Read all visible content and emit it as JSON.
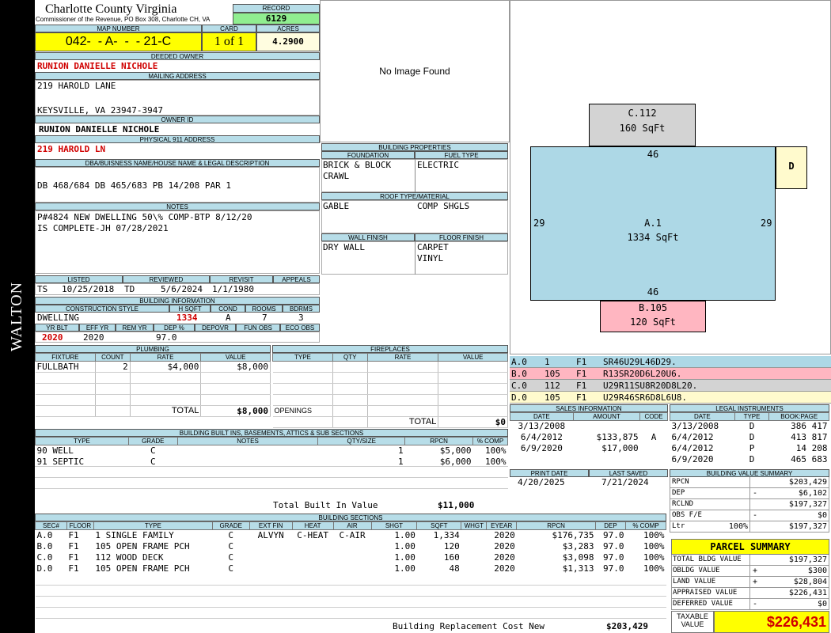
{
  "side_label": "WALTON",
  "header": {
    "county": "Charlotte County Virginia",
    "commissioner": "Commissioner of the Revenue, PO Box 308, Charlotte CH, VA",
    "record_label": "RECORD",
    "record": "6129",
    "map_label": "MAP NUMBER",
    "map_number": "042-  - A-  -  - 21-C",
    "card_label": "CARD",
    "card": "1 of 1",
    "acres_label": "ACRES",
    "acres": "4.2900"
  },
  "owner": {
    "deeded_label": "DEEDED OWNER",
    "deeded": "RUNION DANIELLE NICHOLE",
    "mailing_label": "MAILING ADDRESS",
    "mail1": "219 HAROLD LANE",
    "mail2": "KEYSVILLE, VA 23947-3947",
    "owner_id_label": "OWNER ID",
    "owner_id": "RUNION DANIELLE NICHOLE",
    "physical_label": "PHYSICAL 911 ADDRESS",
    "physical": "219 HAROLD LN",
    "dba_label": "DBA/BUISNESS NAME/HOUSE NAME & LEGAL DESCRIPTION",
    "dba": "DB 468/684 DB 465/683 PB 14/208 PAR 1",
    "notes_label": "NOTES",
    "notes1": "P#4824 NEW DWELLING 50\\% COMP-BTP 8/12/20",
    "notes2": "IS COMPLETE-JH 07/28/2021"
  },
  "photo": {
    "text": "No Image Found"
  },
  "building_props": {
    "title": "BUILDING PROPERTIES",
    "foundation_label": "FOUNDATION",
    "foundation1": "BRICK & BLOCK",
    "foundation2": "CRAWL",
    "fuel_label": "FUEL TYPE",
    "fuel": "ELECTRIC",
    "roof_label": "ROOF TYPE/MATERIAL",
    "roof_type": "GABLE",
    "roof_mat": "COMP SHGLS",
    "wall_label": "WALL FINISH",
    "wall": "DRY WALL",
    "floor_label": "FLOOR FINISH",
    "floor1": "CARPET",
    "floor2": "VINYL"
  },
  "dates": {
    "listed_label": "LISTED",
    "listed_by": "TS",
    "listed": "10/25/2018",
    "reviewed_label": "REVIEWED",
    "reviewed_by": "TD",
    "reviewed": "5/6/2024",
    "revisit_label": "REVISIT",
    "revisit": "1/1/1980",
    "appeals_label": "APPEALS",
    "appeals": ""
  },
  "building_info": {
    "title": "BUILDING INFORMATION",
    "style_label": "CONSTRUCTION STYLE",
    "style": "DWELLING",
    "hsqft_label": "H SQFT",
    "hsqft": "1334",
    "cond_label": "COND",
    "cond": "A",
    "rooms_label": "ROOMS",
    "rooms": "7",
    "bdrms_label": "BDRMS",
    "bdrms": "3",
    "yrblt_label": "YR BLT",
    "yrblt": "2020",
    "effyr_label": "EFF YR",
    "effyr": "2020",
    "remyr_label": "REM YR",
    "remyr": "",
    "dep_label": "DEP %",
    "dep": "97.0",
    "depovr_label": "DEPOVR",
    "depovr": "",
    "funobs_label": "FUN OBS",
    "funobs": "",
    "ecoobs_label": "ECO OBS",
    "ecoobs": ""
  },
  "plumbing": {
    "title": "PLUMBING",
    "headers": [
      "FIXTURE",
      "COUNT",
      "RATE",
      "VALUE"
    ],
    "rows": [
      [
        "FULLBATH",
        "2",
        "$4,000",
        "$8,000"
      ]
    ],
    "total_label": "TOTAL",
    "total": "$8,000"
  },
  "fireplaces": {
    "title": "FIREPLACES",
    "headers": [
      "TYPE",
      "QTY",
      "RATE",
      "VALUE"
    ],
    "openings_label": "OPENINGS",
    "total_label": "TOTAL",
    "total": "$0"
  },
  "builtins": {
    "title": "BUILDING BUILT INS, BASEMENTS, ATTICS & SUB SECTIONS",
    "headers": [
      "TYPE",
      "GRADE",
      "NOTES",
      "QTY/SIZE",
      "RPCN",
      "% COMP"
    ],
    "rows": [
      [
        "90 WELL",
        "C",
        "",
        "1",
        "$5,000",
        "100%"
      ],
      [
        "91 SEPTIC",
        "C",
        "",
        "1",
        "$6,000",
        "100%"
      ]
    ],
    "total_label": "Total Built In Value",
    "total": "$11,000"
  },
  "sections": {
    "title": "BUILDING SECTIONS",
    "headers": [
      "SEC#",
      "FLOOR",
      "TYPE",
      "GRADE",
      "EXT FIN",
      "HEAT",
      "AIR",
      "SHGT",
      "SQFT",
      "WHGT",
      "EYEAR",
      "RPCN",
      "DEP",
      "% COMP"
    ],
    "rows": [
      [
        "A.0",
        "F1",
        "1 SINGLE FAMILY",
        "C",
        "ALVYN",
        "C-HEAT",
        "C-AIR",
        "1.00",
        "1,334",
        "",
        "2020",
        "$176,735",
        "97.0",
        "100%"
      ],
      [
        "B.0",
        "F1",
        "105 OPEN FRAME PCH",
        "C",
        "",
        "",
        "",
        "1.00",
        "120",
        "",
        "2020",
        "$3,283",
        "97.0",
        "100%"
      ],
      [
        "C.0",
        "F1",
        "112 WOOD DECK",
        "C",
        "",
        "",
        "",
        "1.00",
        "160",
        "",
        "2020",
        "$3,098",
        "97.0",
        "100%"
      ],
      [
        "D.0",
        "F1",
        "105 OPEN FRAME PCH",
        "C",
        "",
        "",
        "",
        "1.00",
        "48",
        "",
        "2020",
        "$1,313",
        "97.0",
        "100%"
      ]
    ],
    "total_label": "Building Replacement Cost New",
    "total": "$203,429"
  },
  "sketch": {
    "a_label": "A.1",
    "a_sqft": "1334 SqFt",
    "b_label": "B.105",
    "b_sqft": "120 SqFt",
    "c_label": "C.112",
    "c_sqft": "160 SqFt",
    "d_label": "D",
    "top": "46",
    "bottom": "46",
    "left": "29",
    "right": "29",
    "colors": {
      "a": "#add8e6",
      "b": "#ffb6c1",
      "c": "#d3d3d3",
      "d": "#fffacd"
    }
  },
  "vectors": [
    {
      "sec": "A.0",
      "n": "1",
      "f": "F1",
      "code": "SR46U29L46D29.",
      "color": "#add8e6"
    },
    {
      "sec": "B.0",
      "n": "105",
      "f": "F1",
      "code": "R13SR20D6L20U6.",
      "color": "#ffb6c1"
    },
    {
      "sec": "C.0",
      "n": "112",
      "f": "F1",
      "code": "U29R11SU8R20D8L20.",
      "color": "#d3d3d3"
    },
    {
      "sec": "D.0",
      "n": "105",
      "f": "F1",
      "code": "U29R46SR6D8L6U8.",
      "color": "#fffacd"
    }
  ],
  "sales": {
    "title": "SALES INFORMATION",
    "headers": [
      "DATE",
      "AMOUNT",
      "CODE"
    ],
    "rows": [
      [
        "3/13/2008",
        "",
        ""
      ],
      [
        "6/4/2012",
        "$133,875",
        "A"
      ],
      [
        "6/9/2020",
        "$17,000",
        ""
      ]
    ]
  },
  "legal": {
    "title": "LEGAL INSTRUMENTS",
    "headers": [
      "DATE",
      "TYPE",
      "BOOK:PAGE"
    ],
    "rows": [
      [
        "3/13/2008",
        "D",
        "386 417"
      ],
      [
        "6/4/2012",
        "D",
        "413 817"
      ],
      [
        "6/4/2012",
        "P",
        "14 208"
      ],
      [
        "6/9/2020",
        "D",
        "465 683"
      ]
    ]
  },
  "print": {
    "print_label": "PRINT DATE",
    "print_date": "4/20/2025",
    "saved_label": "LAST SAVED",
    "saved": "7/21/2024"
  },
  "bvs": {
    "title": "BUILDING VALUE SUMMARY",
    "rows": [
      {
        "label": "RPCN",
        "pct": "",
        "sign": "",
        "value": "$203,429"
      },
      {
        "label": "DEP",
        "pct": "",
        "sign": "-",
        "value": "$6,102"
      },
      {
        "label": "RCLND",
        "pct": "",
        "sign": "",
        "value": "$197,327"
      },
      {
        "label": "OBS F/E",
        "pct": "",
        "sign": "-",
        "value": "$0"
      },
      {
        "label": "Ltr",
        "pct": "100%",
        "sign": "",
        "value": "$197,327"
      }
    ]
  },
  "parcel": {
    "title": "PARCEL SUMMARY",
    "rows": [
      {
        "label": "TOTAL BLDG VALUE",
        "sign": "",
        "value": "$197,327"
      },
      {
        "label": "OBLDG VALUE",
        "sign": "+",
        "value": "$300"
      },
      {
        "label": "LAND VALUE",
        "sign": "+",
        "value": "$28,804"
      },
      {
        "label": "APPRAISED VALUE",
        "sign": "",
        "value": "$226,431"
      },
      {
        "label": "DEFERRED VALUE",
        "sign": "-",
        "value": "$0"
      }
    ],
    "taxable_label1": "TAXABLE",
    "taxable_label2": "VALUE",
    "taxable": "$226,431"
  }
}
